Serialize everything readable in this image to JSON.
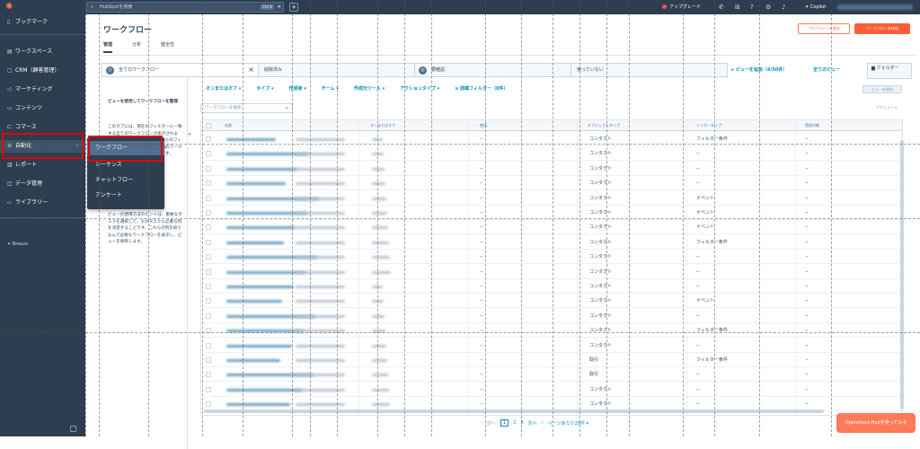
{
  "topbar": {
    "search_placeholder": "HubSpotを検索",
    "search_shortcut": "Ctrl K",
    "upgrade_label": "アップグレード",
    "copilot_label": "Copilot"
  },
  "sidebar": {
    "items": [
      {
        "icon": "bookmark-icon",
        "label": "ブックマーク"
      },
      {
        "icon": "workspace-icon",
        "label": "ワークスペース"
      },
      {
        "icon": "contacts-icon",
        "label": "CRM（顧客管理）"
      },
      {
        "icon": "megaphone-icon",
        "label": "マーケティング"
      },
      {
        "icon": "content-icon",
        "label": "コンテンツ"
      },
      {
        "icon": "cart-icon",
        "label": "コマース"
      },
      {
        "icon": "automation-icon",
        "label": "自動化"
      },
      {
        "icon": "reports-icon",
        "label": "レポート"
      },
      {
        "icon": "data-icon",
        "label": "データ管理"
      },
      {
        "icon": "library-icon",
        "label": "ライブラリー"
      }
    ],
    "breeze_label": "Breeze"
  },
  "flyout": {
    "items": [
      "ワークフロー",
      "シーケンス",
      "チャットフロー",
      "アンケート"
    ]
  },
  "page": {
    "title": "ワークフロー",
    "tabs": [
      "管理",
      "分析",
      "健全性"
    ],
    "button_secondary": "プロパティーを確認",
    "button_primary": "ワークフローを作成"
  },
  "views": {
    "tabs": [
      "全てのワークフロー",
      "削除済み",
      "要確認",
      "使っていない"
    ],
    "add_view": "+ ビューを追加（4/50件）",
    "all_views": "全てのビュー",
    "folder": "フォルダー"
  },
  "filters": [
    "オンまたはオフ ▾",
    "タイプ ▾",
    "作成者 ▾",
    "チーム ▾",
    "作成元ツール ▾",
    "アクションタイプ ▾",
    "≡ 詳細フィルター（0件）"
  ],
  "view_save": "ビューを保存",
  "table_search_placeholder": "ワークフローを検索",
  "actions_label": "アクション ▾",
  "left_panel": {
    "heading": "ビューを使用してワークフローを整理",
    "para1": "このタブには、現在のフィルターに一致する全てのワークフローが表示されます。ビューを使用すると、これらのフィルターを保存して、特定の種類のワークフローに簡単にアクセスできます。",
    "para2": "ビューの使用方法のヒントは、重要なタスクを選択して、そのタスクに必要な列を決定することです。これらの列を絞り込んで必要なワークフローを表示し、ビューを保存します。"
  },
  "table": {
    "headers": [
      "名前",
      "オンまたはオフ",
      "使用",
      "オブジェクトタイプ",
      "トリガータイプ",
      "登録対象"
    ],
    "rows": [
      {
        "object": "コンタクト",
        "trigger": "フィルター条件"
      },
      {
        "object": "コンタクト",
        "trigger": "--"
      },
      {
        "object": "コンタクト",
        "trigger": "--"
      },
      {
        "object": "コンタクト",
        "trigger": "--"
      },
      {
        "object": "コンタクト",
        "trigger": "イベント"
      },
      {
        "object": "コンタクト",
        "trigger": "イベント"
      },
      {
        "object": "コンタクト",
        "trigger": "イベント"
      },
      {
        "object": "コンタクト",
        "trigger": "フィルター条件"
      },
      {
        "object": "コンタクト",
        "trigger": "--"
      },
      {
        "object": "コンタクト",
        "trigger": "--"
      },
      {
        "object": "コンタクト",
        "trigger": "--"
      },
      {
        "object": "コンタクト",
        "trigger": "イベント"
      },
      {
        "object": "コンタクト",
        "trigger": "--"
      },
      {
        "object": "コンタクト",
        "trigger": "フィルター条件"
      },
      {
        "object": "コンタクト",
        "trigger": "--"
      },
      {
        "object": "取引",
        "trigger": "フィルター条件"
      },
      {
        "object": "取引",
        "trigger": "--"
      },
      {
        "object": "コンタクト",
        "trigger": "--"
      },
      {
        "object": "コンタクト",
        "trigger": "--"
      }
    ],
    "dash": "--"
  },
  "pager": {
    "prev": "前へ",
    "pages": [
      "1",
      "2",
      "3"
    ],
    "next": "次へ",
    "per_page": "ページあたり25件 ▾"
  },
  "ops_button": "Operations Hubを使ってみる"
}
